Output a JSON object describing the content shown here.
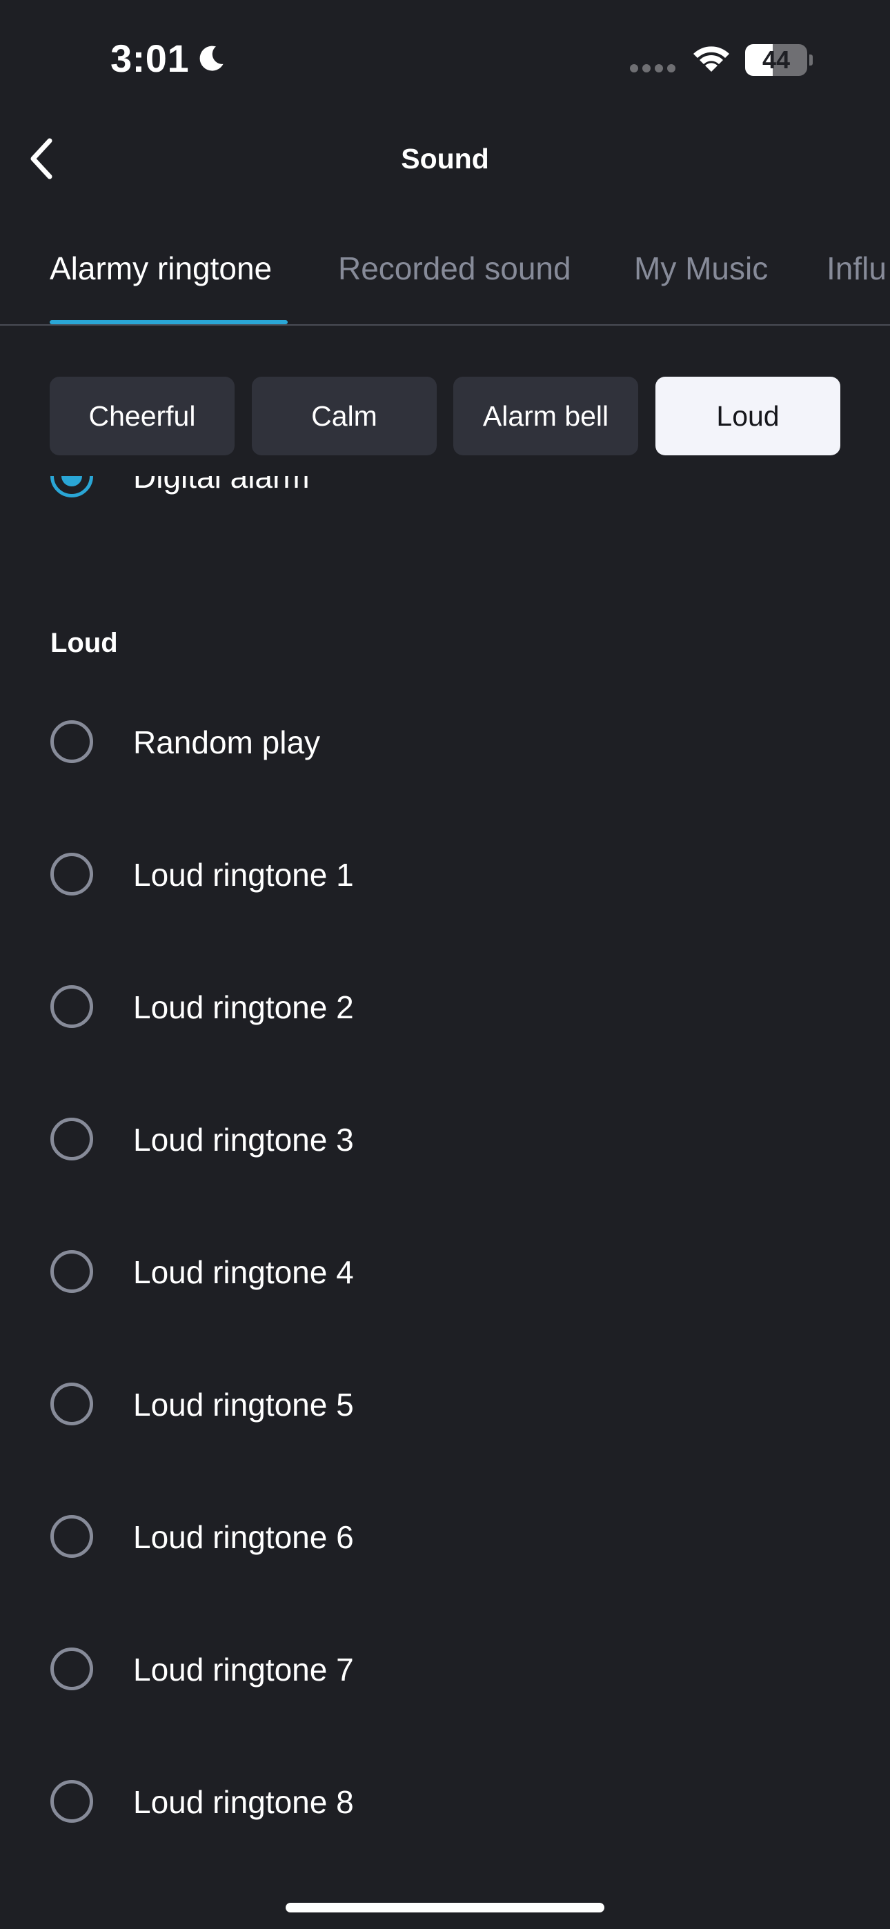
{
  "status_bar": {
    "time": "3:01",
    "battery_level": "44",
    "battery_fraction": 0.44,
    "focus_icon": "moon-icon",
    "signal_icon": "cellular-signal-icon",
    "wifi_icon": "wifi-icon"
  },
  "header": {
    "title": "Sound",
    "back_icon": "chevron-left-icon"
  },
  "tabs": [
    {
      "label": "Alarmy ringtone",
      "active": true
    },
    {
      "label": "Recorded sound",
      "active": false
    },
    {
      "label": "My Music",
      "active": false
    },
    {
      "label": "Influ",
      "active": false
    }
  ],
  "categories": [
    {
      "label": "Cheerful",
      "selected": false
    },
    {
      "label": "Calm",
      "selected": false
    },
    {
      "label": "Alarm bell",
      "selected": false
    },
    {
      "label": "Loud",
      "selected": true
    }
  ],
  "partial_item": {
    "label": "Digital alarm",
    "selected": true
  },
  "section": {
    "title": "Loud",
    "items": [
      {
        "label": "Random play",
        "selected": false
      },
      {
        "label": "Loud ringtone 1",
        "selected": false
      },
      {
        "label": "Loud ringtone 2",
        "selected": false
      },
      {
        "label": "Loud ringtone 3",
        "selected": false
      },
      {
        "label": "Loud ringtone 4",
        "selected": false
      },
      {
        "label": "Loud ringtone 5",
        "selected": false
      },
      {
        "label": "Loud ringtone 6",
        "selected": false
      },
      {
        "label": "Loud ringtone 7",
        "selected": false
      },
      {
        "label": "Loud ringtone 8",
        "selected": false
      }
    ]
  },
  "colors": {
    "background": "#1e1f24",
    "accent": "#2aa6d6",
    "chip": "#30323b",
    "chip_selected": "#f3f4fa",
    "inactive_text": "#878b99"
  }
}
